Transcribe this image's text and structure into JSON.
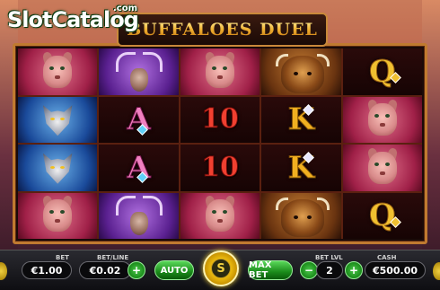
{
  "watermark": {
    "part1": "Slot",
    "part2": "Catalog",
    "dotcom": ".com"
  },
  "title": "BUFFALOES DUEL",
  "reels": [
    [
      "cougar",
      "deer",
      "cougar",
      "bison",
      "Q"
    ],
    [
      "wolf",
      "A",
      "10",
      "K",
      "cougar"
    ],
    [
      "wolf",
      "A",
      "10",
      "K",
      "cougar"
    ],
    [
      "cougar",
      "deer",
      "cougar",
      "bison",
      "Q"
    ]
  ],
  "controls": {
    "bet_label": "BET",
    "bet_value": "€1.00",
    "betline_label": "BET/LINE",
    "betline_value": "€0.02",
    "betline_plus": "+",
    "auto_label": "AUTO",
    "spin_icon_text": "S",
    "maxbet_label": "MAX BET",
    "betlvl_label": "BET LVL",
    "betlvl_minus": "−",
    "betlvl_value": "2",
    "betlvl_plus": "+",
    "cash_label": "CASH",
    "cash_value": "€500.00"
  },
  "colors": {
    "accent_green": "#1a8a1a",
    "spin_gold": "#f0c010",
    "frame_gold": "#c07a30"
  }
}
